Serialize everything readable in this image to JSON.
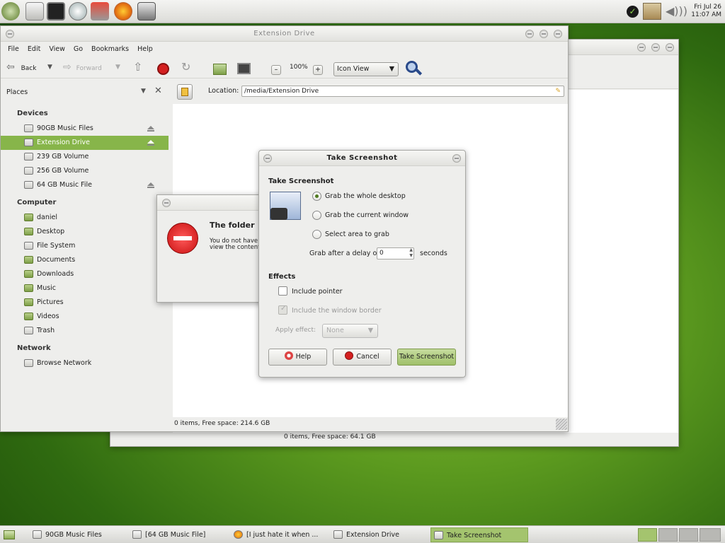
{
  "top_panel": {
    "launchers": [
      "menu-icon",
      "files-icon",
      "terminal-icon",
      "system-monitor-icon",
      "software-icon",
      "firefox-icon",
      "screenshot-icon"
    ],
    "tray": [
      "update-ok-icon",
      "clipboard-icon",
      "volume-icon"
    ],
    "clock_day": "Fri Jul 26",
    "clock_time": "11:07 AM"
  },
  "back_window": {
    "status": "0 items, Free space: 64.1 GB"
  },
  "nautilus": {
    "title": "Extension Drive",
    "menus": [
      "File",
      "Edit",
      "View",
      "Go",
      "Bookmarks",
      "Help"
    ],
    "toolbar": {
      "back": "Back",
      "forward": "Forward",
      "zoom": "100%",
      "view_mode": "Icon View"
    },
    "sidebar": {
      "title": "Places",
      "devices_header": "Devices",
      "devices": [
        "90GB Music Files",
        "Extension Drive",
        "239 GB Volume",
        "256 GB Volume",
        "64 GB Music File"
      ],
      "computer_header": "Computer",
      "computer": [
        "daniel",
        "Desktop",
        "File System",
        "Documents",
        "Downloads",
        "Music",
        "Pictures",
        "Videos",
        "Trash"
      ],
      "network_header": "Network",
      "network": [
        "Browse Network"
      ]
    },
    "location_label": "Location:",
    "location_value": "/media/Extension Drive",
    "status": "0 items, Free space: 214.6 GB"
  },
  "error_dialog": {
    "heading": "The folder",
    "body_line1": "You do not have",
    "body_line2": "view the content"
  },
  "screenshot_dialog": {
    "title": "Take Screenshot",
    "section_title": "Take Screenshot",
    "options": [
      "Grab the whole desktop",
      "Grab the current window",
      "Select area to grab"
    ],
    "selected_option": 0,
    "delay_label": "Grab after a delay of",
    "delay_value": "0",
    "delay_unit": "seconds",
    "effects_title": "Effects",
    "include_pointer": "Include pointer",
    "include_border": "Include the window border",
    "apply_effect_label": "Apply effect:",
    "apply_effect_value": "None",
    "help_button": "Help",
    "cancel_button": "Cancel",
    "take_button": "Take Screenshot"
  },
  "taskbar": {
    "tasks": [
      "90GB Music Files",
      "[64 GB Music File]",
      "[I just hate it when ...",
      "Extension Drive",
      "Take Screenshot"
    ],
    "active_task": 4
  },
  "colors": {
    "accent_green": "#87b54a",
    "stop_red": "#d42020"
  }
}
